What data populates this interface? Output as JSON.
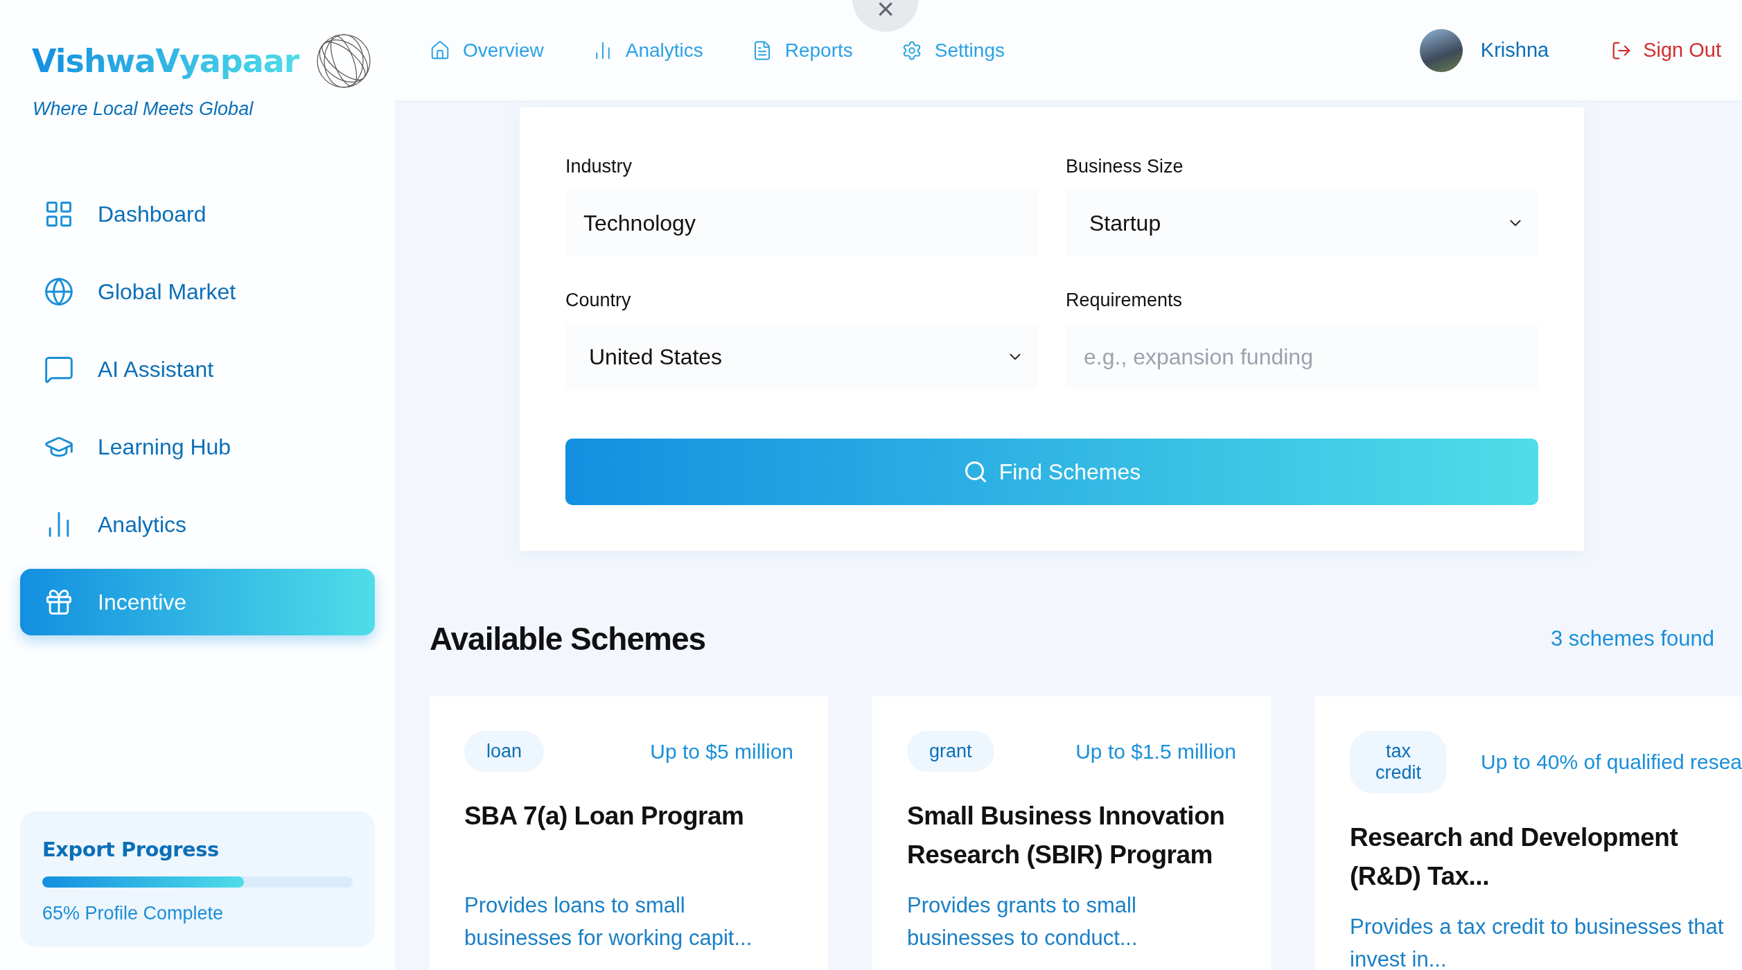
{
  "brand": {
    "name": "VishwaVyapaar",
    "tagline": "Where Local Meets Global"
  },
  "sidebar": {
    "items": [
      {
        "label": "Dashboard",
        "selected": false
      },
      {
        "label": "Global Market",
        "selected": false
      },
      {
        "label": "AI Assistant",
        "selected": false
      },
      {
        "label": "Learning Hub",
        "selected": false
      },
      {
        "label": "Analytics",
        "selected": false
      },
      {
        "label": "Incentive",
        "selected": true
      }
    ],
    "progress": {
      "title": "Export Progress",
      "level": 0.65,
      "caption": "65% Profile Complete"
    }
  },
  "overlay_close": {
    "label": "×"
  },
  "top_nav": {
    "items": [
      {
        "label": "Overview"
      },
      {
        "label": "Analytics"
      },
      {
        "label": "Reports"
      },
      {
        "label": "Settings"
      }
    ],
    "user": {
      "name": "Krishna"
    },
    "sign_out": "Sign Out"
  },
  "filters": {
    "fields": [
      {
        "label": "Industry",
        "kind": "input",
        "value": "Technology"
      },
      {
        "label": "Business Size",
        "kind": "select",
        "value": "Startup"
      },
      {
        "label": "Country",
        "kind": "select",
        "value": "United States"
      },
      {
        "label": "Requirements",
        "kind": "input",
        "placeholder": "e.g., expansion funding"
      }
    ],
    "button": "Find Schemes"
  },
  "results": {
    "title": "Available Schemes",
    "count": "3 schemes found",
    "schemes": [
      {
        "type": "loan",
        "amount": "Up to $5 million",
        "name": "SBA 7(a) Loan Program",
        "description": "Provides loans to small businesses for working capit..."
      },
      {
        "type": "grant",
        "amount": "Up to $1.5 million",
        "name": "Small Business Innovation Research (SBIR) Program",
        "description": "Provides grants to small businesses to conduct..."
      },
      {
        "type": "tax credit",
        "amount": "Up to 40% of qualified resea",
        "name": "Research and Development (R&D) Tax...",
        "description": "Provides a tax credit to businesses that invest in..."
      }
    ]
  }
}
